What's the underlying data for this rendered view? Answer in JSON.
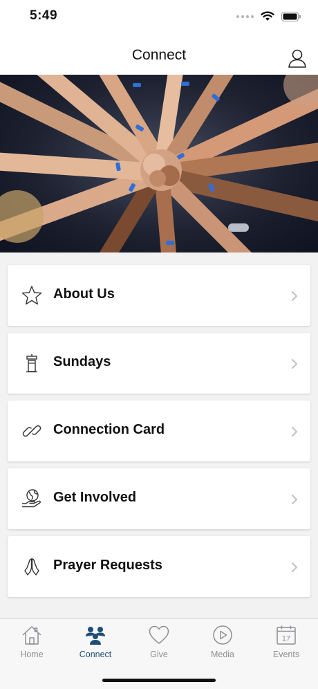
{
  "status_bar": {
    "time": "5:49"
  },
  "nav": {
    "title": "Connect",
    "profile_icon": "user-icon"
  },
  "hero": {
    "image_icon": "hands-together-photo"
  },
  "menu": [
    {
      "label": "About Us",
      "icon": "star-icon"
    },
    {
      "label": "Sundays",
      "icon": "podium-icon"
    },
    {
      "label": "Connection Card",
      "icon": "link-icon"
    },
    {
      "label": "Get Involved",
      "icon": "globe-hand-icon"
    },
    {
      "label": "Prayer Requests",
      "icon": "praying-hands-icon"
    }
  ],
  "tabs": [
    {
      "label": "Home",
      "icon": "home-icon"
    },
    {
      "label": "Connect",
      "icon": "people-icon",
      "active": true
    },
    {
      "label": "Give",
      "icon": "heart-icon"
    },
    {
      "label": "Media",
      "icon": "play-icon"
    },
    {
      "label": "Events",
      "icon": "calendar-icon",
      "calendar_day": "17"
    }
  ],
  "colors": {
    "accent": "#1d4e78",
    "inactive": "#8e8e93",
    "background": "#f2f2f2"
  }
}
